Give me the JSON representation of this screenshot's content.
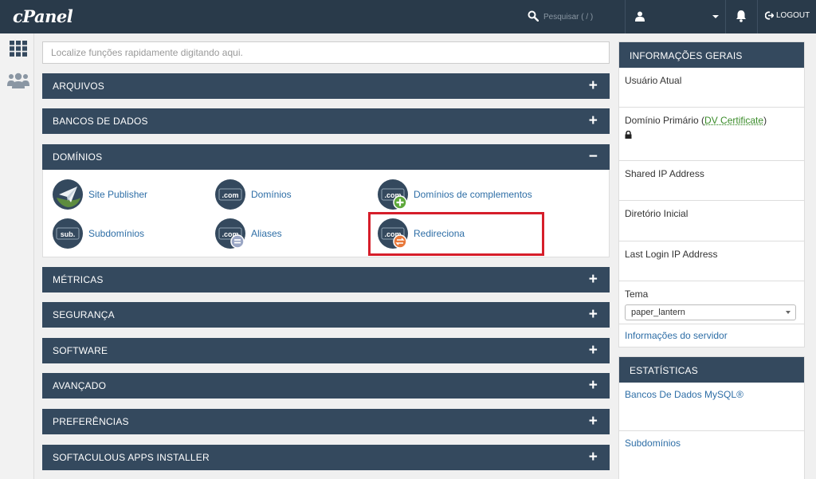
{
  "header": {
    "logo": "cPanel",
    "search_placeholder": "Pesquisar ( / )",
    "logout_label": "LOGOUT"
  },
  "quick_search": {
    "placeholder": "Localize funções rapidamente digitando aqui."
  },
  "sections": {
    "arquivos": {
      "label": "ARQUIVOS",
      "toggle": "+"
    },
    "bancos": {
      "label": "BANCOS DE DADOS",
      "toggle": "+"
    },
    "dominios": {
      "label": "DOMÍNIOS",
      "toggle": "−"
    },
    "metricas": {
      "label": "MÉTRICAS",
      "toggle": "+"
    },
    "seguranca": {
      "label": "SEGURANÇA",
      "toggle": "+"
    },
    "software": {
      "label": "SOFTWARE",
      "toggle": "+"
    },
    "avancado": {
      "label": "AVANÇADO",
      "toggle": "+"
    },
    "preferencias": {
      "label": "PREFERÊNCIAS",
      "toggle": "+"
    },
    "softaculous": {
      "label": "SOFTACULOUS APPS INSTALLER",
      "toggle": "+"
    }
  },
  "domains": {
    "site_publisher": "Site Publisher",
    "dominios": "Domínios",
    "complementos": "Domínios de complementos",
    "subdominios": "Subdomínios",
    "aliases": "Aliases",
    "redireciona": "Redireciona",
    "com_text": ".com",
    "sub_text": "sub."
  },
  "info": {
    "title": "INFORMAÇÕES GERAIS",
    "usuario_atual": "Usuário Atual",
    "dominio_primario": "Domínio Primário (",
    "dv_certificate": "DV Certificate",
    "paren_close": ")",
    "shared_ip": "Shared IP Address",
    "diretorio_inicial": "Diretório Inicial",
    "last_login": "Last Login IP Address",
    "tema_label": "Tema",
    "tema_value": "paper_lantern",
    "server_info_link": "Informações do servidor"
  },
  "stats": {
    "title": "ESTATÍSTICAS",
    "mysql": "Bancos De Dados MySQL®",
    "subdominios": "Subdomínios"
  },
  "colors": {
    "header_bg": "#293a4a",
    "panel_bg": "#34495e",
    "link": "#2e6ea6",
    "highlight": "#d61e2a"
  }
}
